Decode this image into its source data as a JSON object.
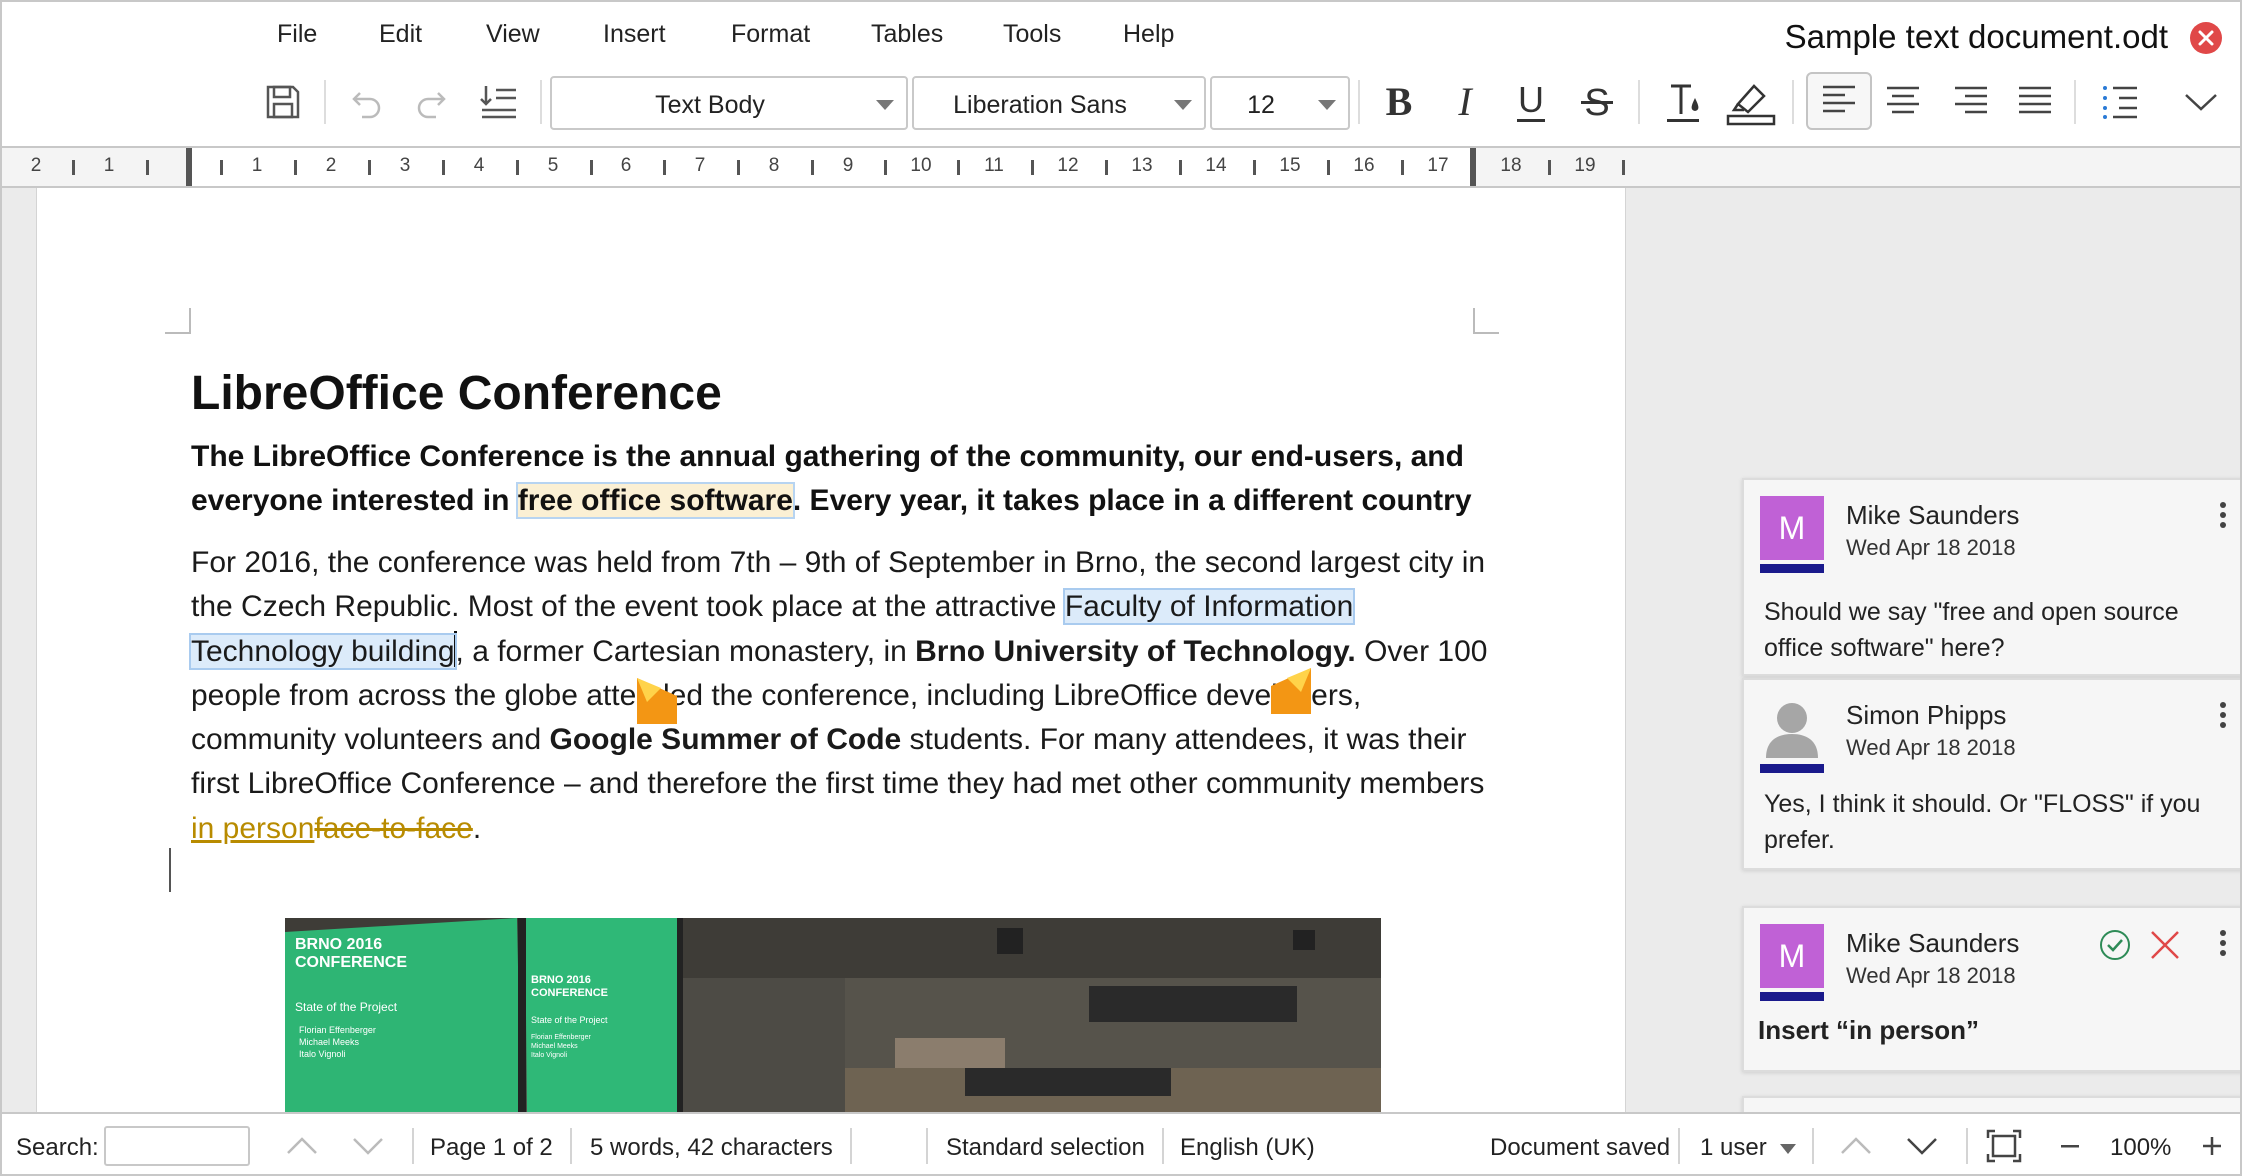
{
  "app": {
    "document_title": "Sample text document.odt"
  },
  "menubar": {
    "items": [
      "File",
      "Edit",
      "View",
      "Insert",
      "Format",
      "Tables",
      "Tools",
      "Help"
    ]
  },
  "toolbar": {
    "paragraph_style": "Text Body",
    "font_name": "Liberation Sans",
    "font_size": "12",
    "icons": [
      "save-icon",
      "undo-icon",
      "redo-icon",
      "line-spacing-icon",
      "bold-icon",
      "italic-icon",
      "underline-icon",
      "strikethrough-icon",
      "text-color-icon",
      "highlight-icon",
      "align-left-icon",
      "align-center-icon",
      "align-right-icon",
      "justify-icon",
      "list-icon",
      "more-icon"
    ],
    "accent_colors": {
      "close": "#e04848",
      "author_avatar": "#c061d6",
      "author_bar": "#1a1a8c",
      "tracked_change": "#b88b00"
    }
  },
  "ruler": {
    "labels": [
      "2",
      "1",
      "1",
      "2",
      "3",
      "4",
      "5",
      "6",
      "7",
      "8",
      "9",
      "10",
      "11",
      "12",
      "13",
      "14",
      "15",
      "16",
      "17",
      "18",
      "19"
    ]
  },
  "document": {
    "heading": "LibreOffice Conference",
    "lead_part1": "The LibreOffice Conference is the annual gathering of the community, our end-users, and everyone interested in ",
    "lead_highlight": "free office software",
    "lead_part2": ". Every year, it takes place in a different country",
    "body_part1": "For 2016, the conference was held from 7th – 9th of September in Brno, the second largest city in the Czech Republic. Most of the event took place at the attractive ",
    "body_selection": "Faculty of Information Technology building",
    "body_part2": ", a former Cartesian monastery, in ",
    "body_bold1": "Brno University of Technology.",
    "body_part3": " Over 100 people from across the globe attended the conference, including LibreOffice developers, community volunteers and ",
    "body_bold2": "Google Summer of Code",
    "body_part4": " students. For many attendees, it was their first LibreOffice Conference – and therefore the first time they had met other community members ",
    "inserted_text": "in person",
    "deleted_text": "face-to-face",
    "body_end": ".",
    "photo_screen_left": {
      "title1": "BRNO 2016",
      "title2": "CONFERENCE",
      "subtitle": "State of the Project",
      "names": [
        "Florian Effenberger",
        "Michael Meeks",
        "Italo Vignoli"
      ]
    },
    "photo_screen_right": {
      "title1": "BRNO 2016",
      "title2": "CONFERENCE",
      "subtitle": "State of the Project",
      "names": [
        "Florian Effenberger",
        "Michael Meeks",
        "Italo Vignoli"
      ]
    }
  },
  "comments": [
    {
      "author": "Mike Saunders",
      "initial": "M",
      "date": "Wed Apr 18 2018",
      "text": "Should we say \"free and open source office software\" here?"
    },
    {
      "author": "Simon Phipps",
      "initial": "",
      "date": "Wed Apr 18 2018",
      "text": "Yes, I think it should. Or \"FLOSS\" if you prefer."
    },
    {
      "author": "Mike Saunders",
      "initial": "M",
      "date": "Wed Apr 18 2018",
      "text": "Insert “in person”"
    }
  ],
  "statusbar": {
    "search_label": "Search:",
    "search_value": "",
    "page": "Page 1 of 2",
    "word_count": "5 words, 42 characters",
    "selection_mode": "Standard selection",
    "language": "English (UK)",
    "save_status": "Document saved",
    "users": "1 user",
    "zoom": "100%"
  }
}
